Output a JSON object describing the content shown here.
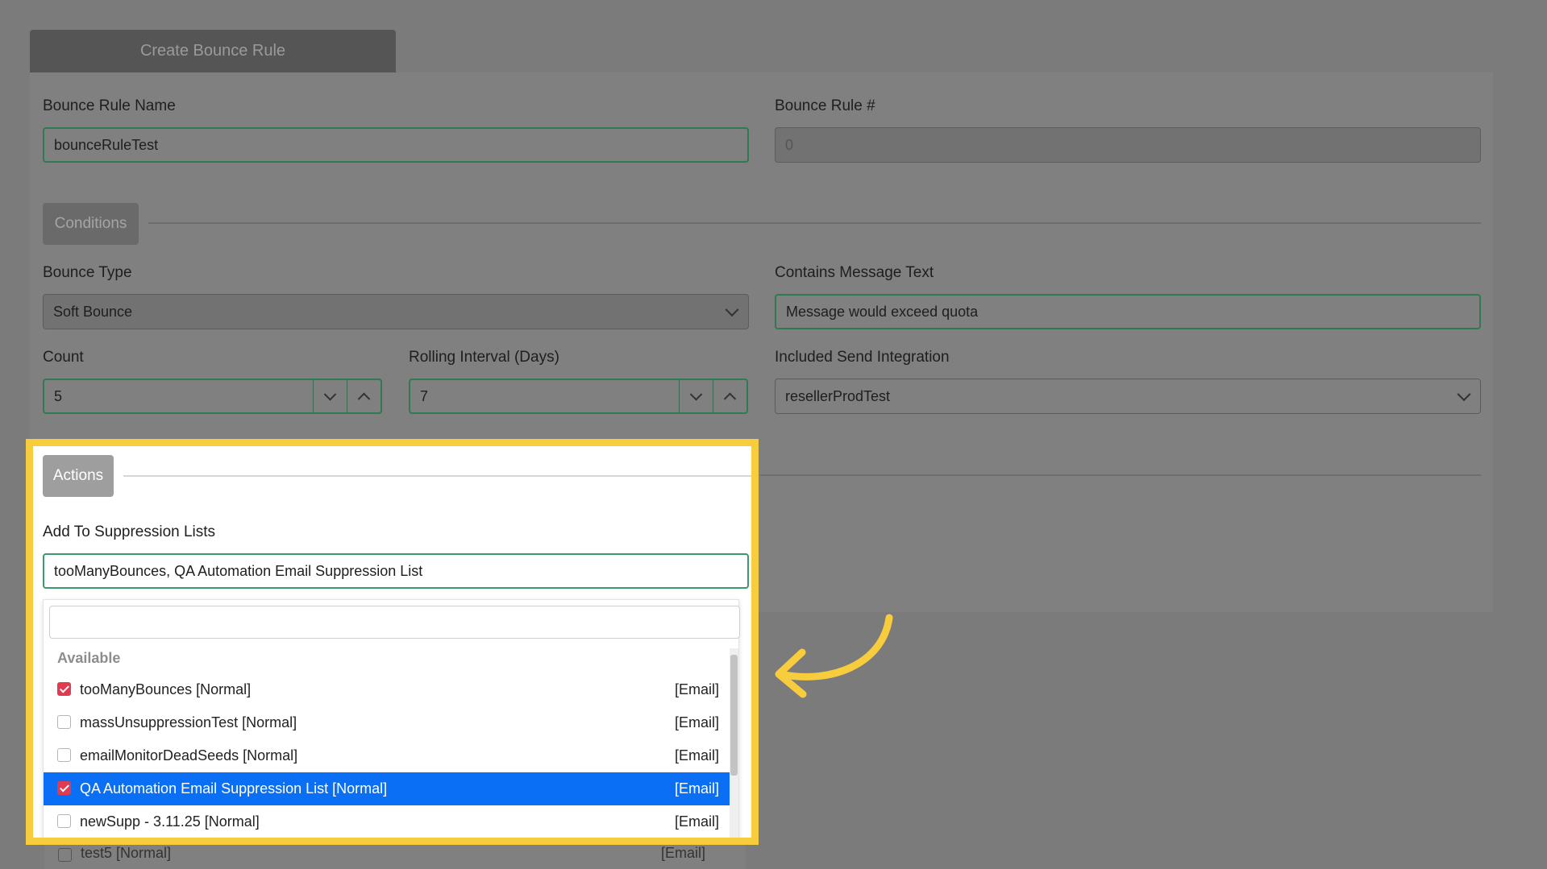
{
  "header": {
    "title": "Create Bounce Rule"
  },
  "rule_name": {
    "label": "Bounce Rule Name",
    "value": "bounceRuleTest"
  },
  "rule_number": {
    "label": "Bounce Rule #",
    "value": "0"
  },
  "conditions": {
    "label": "Conditions",
    "bounce_type": {
      "label": "Bounce Type",
      "value": "Soft Bounce"
    },
    "message_text": {
      "label": "Contains Message Text",
      "value": "Message would exceed quota"
    },
    "count": {
      "label": "Count",
      "value": "5"
    },
    "rolling_interval": {
      "label": "Rolling Interval (Days)",
      "value": "7"
    },
    "send_integration": {
      "label": "Included Send Integration",
      "value": "resellerProdTest"
    }
  },
  "actions": {
    "label": "Actions",
    "suppression": {
      "label": "Add To Suppression Lists",
      "value": "tooManyBounces, QA Automation Email Suppression List",
      "group_label": "Available",
      "options": [
        {
          "label": "tooManyBounces [Normal]",
          "tag": "[Email]",
          "checked": true,
          "highlighted": false
        },
        {
          "label": "massUnsuppressionTest [Normal]",
          "tag": "[Email]",
          "checked": false,
          "highlighted": false
        },
        {
          "label": "emailMonitorDeadSeeds [Normal]",
          "tag": "[Email]",
          "checked": false,
          "highlighted": false
        },
        {
          "label": "QA Automation Email Suppression List [Normal]",
          "tag": "[Email]",
          "checked": true,
          "highlighted": true
        },
        {
          "label": "newSupp - 3.11.25 [Normal]",
          "tag": "[Email]",
          "checked": false,
          "highlighted": false
        },
        {
          "label": "test5 [Normal]",
          "tag": "[Email]",
          "checked": false,
          "highlighted": false
        }
      ]
    }
  },
  "colors": {
    "highlight": "#f7cd3d",
    "selected": "#0a6ff5",
    "checkbox": "#e23a4e"
  }
}
